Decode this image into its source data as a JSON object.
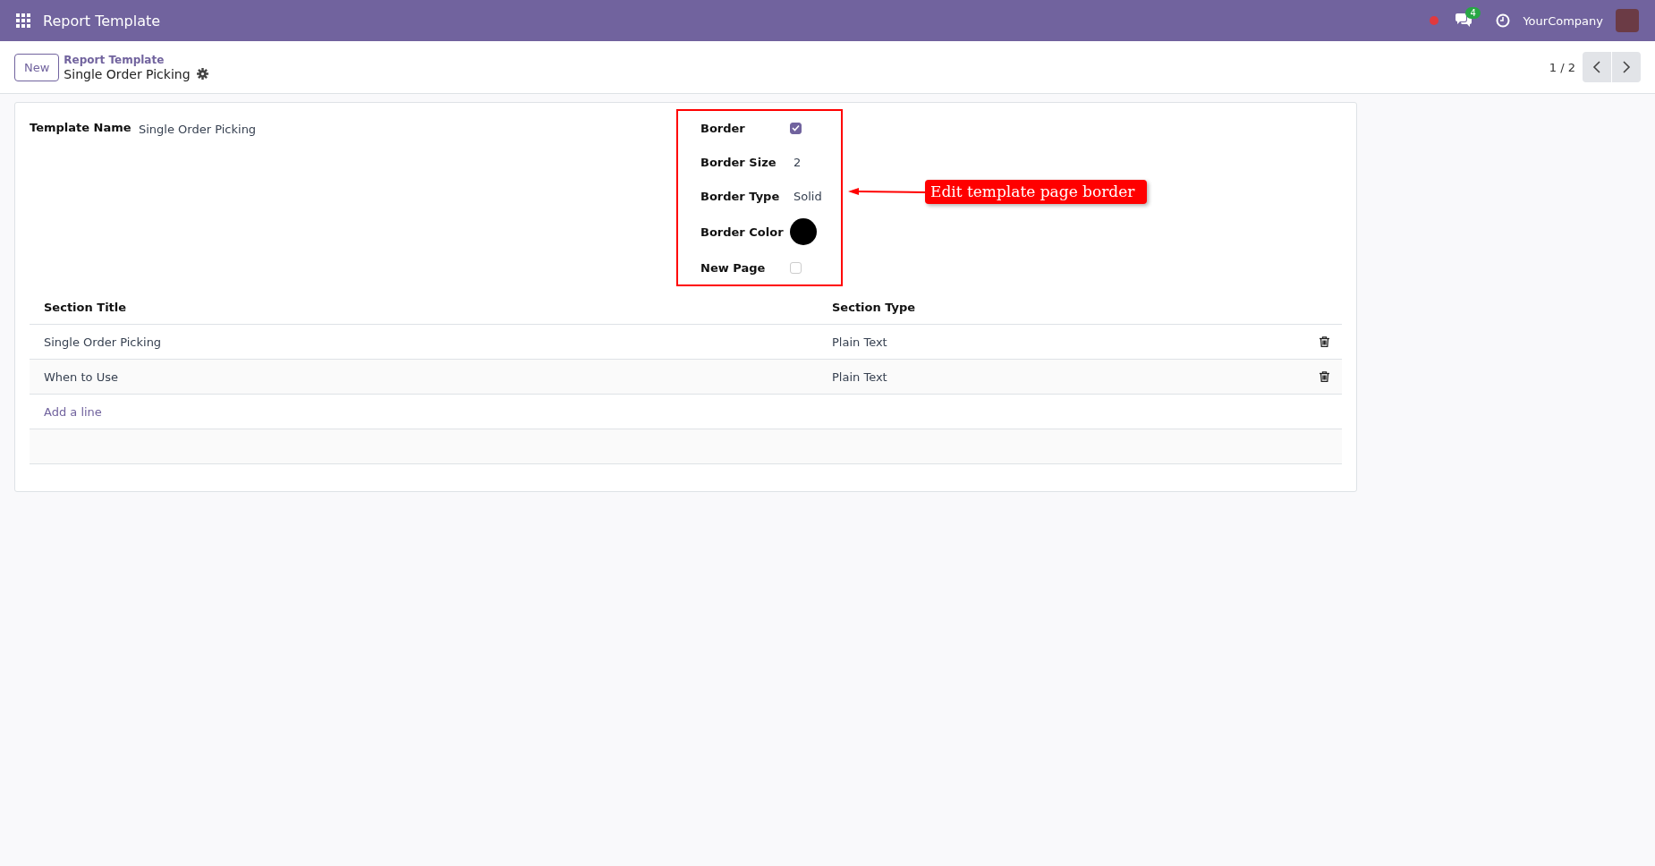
{
  "navbar": {
    "app_title": "Report Template",
    "messages_badge": "4",
    "company": "YourCompany"
  },
  "control_panel": {
    "new_button": "New",
    "breadcrumb": "Report Template",
    "record_name": "Single Order Picking",
    "pager": "1 / 2"
  },
  "form": {
    "template_name": {
      "label": "Template Name",
      "value": "Single Order Picking"
    },
    "options": [
      {
        "kind": "checkbox",
        "label": "Border",
        "checked": true
      },
      {
        "kind": "text",
        "label": "Border Size",
        "value": "2"
      },
      {
        "kind": "text",
        "label": "Border Type",
        "value": "Solid"
      },
      {
        "kind": "color",
        "label": "Border Color",
        "color": "#000000"
      },
      {
        "kind": "checkbox",
        "label": "New Page",
        "checked": false
      }
    ],
    "table": {
      "columns": [
        "Section Title",
        "Section Type"
      ],
      "rows": [
        {
          "title": "Single Order Picking",
          "type": "Plain Text"
        },
        {
          "title": "When to Use",
          "type": "Plain Text"
        }
      ],
      "add_line": "Add a line"
    }
  },
  "annotation": {
    "text": "Edit template page border"
  }
}
